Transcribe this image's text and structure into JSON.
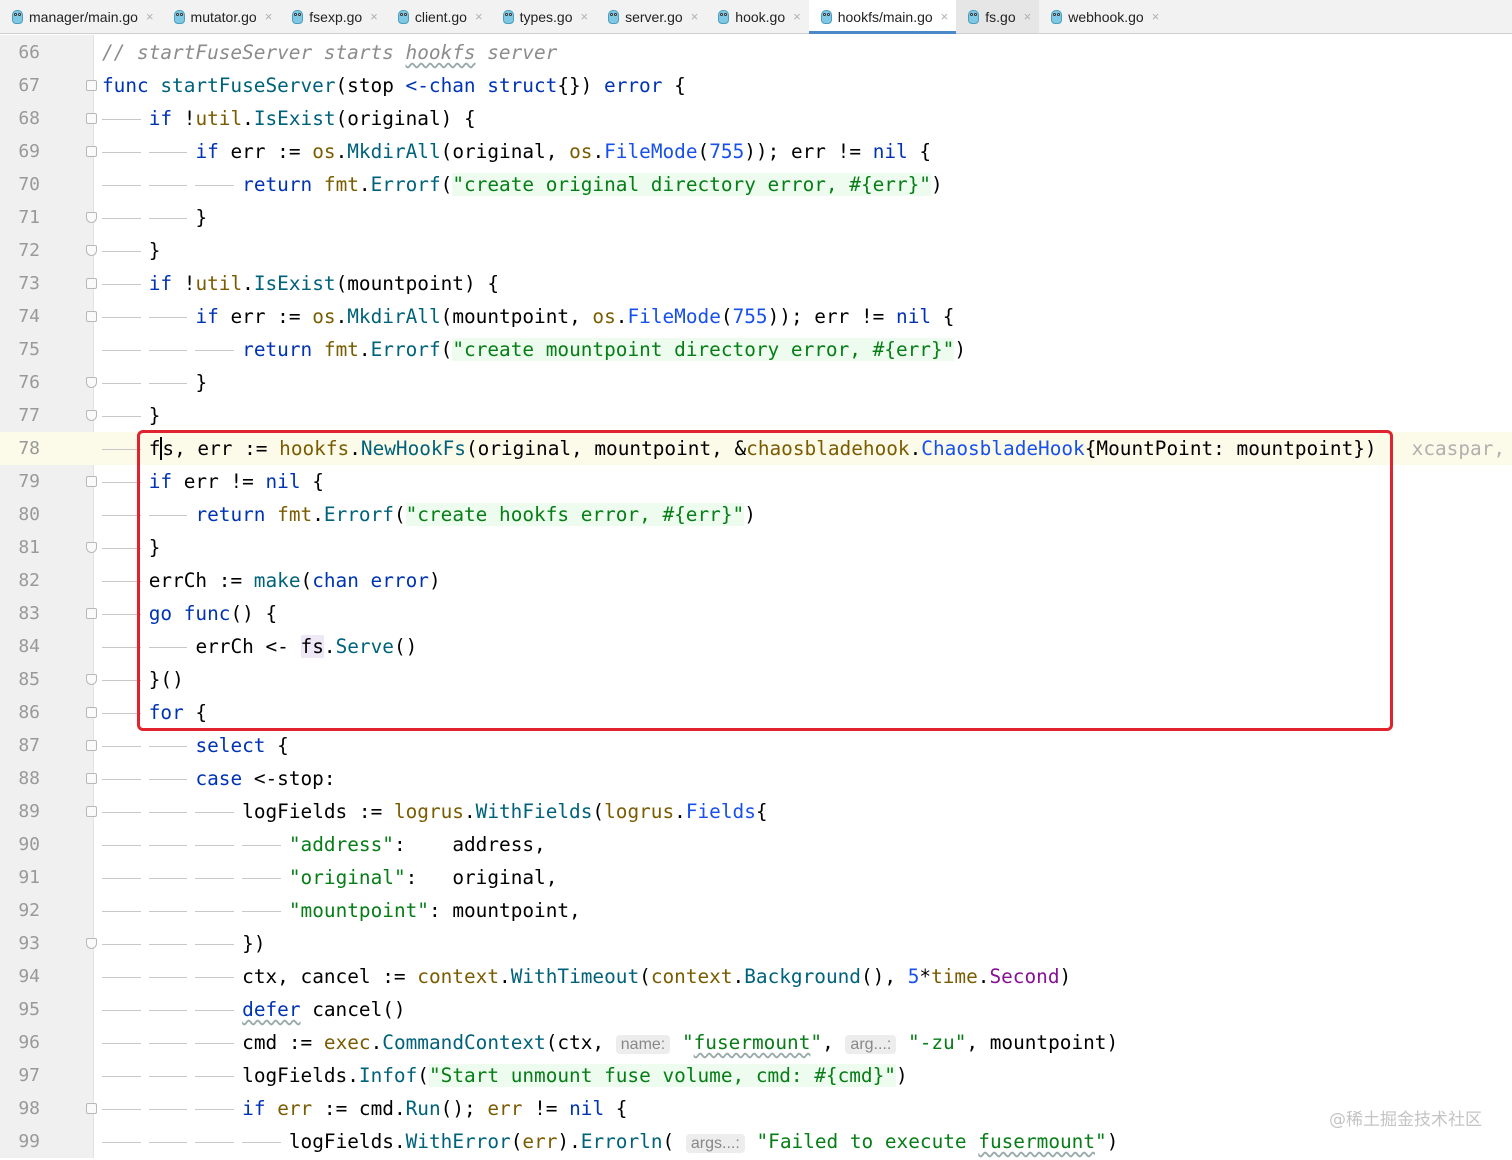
{
  "tabs": [
    {
      "label": "manager/main.go"
    },
    {
      "label": "mutator.go"
    },
    {
      "label": "fsexp.go"
    },
    {
      "label": "client.go"
    },
    {
      "label": "types.go"
    },
    {
      "label": "server.go"
    },
    {
      "label": "hook.go"
    },
    {
      "label": "hookfs/main.go",
      "active": true
    },
    {
      "label": "fs.go"
    },
    {
      "label": "webhook.go"
    }
  ],
  "tab_close_glyph": "×",
  "colors": {
    "active_tab_accent": "#4a88c7",
    "selection_box": "#e0232e",
    "keyword": "#0033b3",
    "string": "#067d17"
  },
  "current_line": 78,
  "highlight_box_lines": [
    78,
    85
  ],
  "watermark": "@稀土掘金技术社区",
  "lines": [
    {
      "n": 66,
      "indent": 0,
      "fold": "",
      "tokens": [
        [
          "cm",
          "// startFuseServer starts "
        ],
        [
          "cm sq",
          "hookfs"
        ],
        [
          "cm",
          " server"
        ]
      ]
    },
    {
      "n": 67,
      "indent": 0,
      "fold": "start",
      "tokens": [
        [
          "kw",
          "func "
        ],
        [
          "fn",
          "startFuseServer"
        ],
        [
          "",
          "(stop "
        ],
        [
          "kw",
          "<-chan struct"
        ],
        [
          "",
          "{}) "
        ],
        [
          "kw",
          "error"
        ],
        [
          "",
          " {"
        ]
      ]
    },
    {
      "n": 68,
      "indent": 1,
      "fold": "start",
      "tokens": [
        [
          "kw",
          "if "
        ],
        [
          "",
          "!"
        ],
        [
          "pk",
          "util"
        ],
        [
          "",
          "."
        ],
        [
          "mt",
          "IsExist"
        ],
        [
          "",
          "(original) {"
        ]
      ]
    },
    {
      "n": 69,
      "indent": 2,
      "fold": "start",
      "tokens": [
        [
          "kw",
          "if "
        ],
        [
          "",
          "err := "
        ],
        [
          "pk",
          "os"
        ],
        [
          "",
          "."
        ],
        [
          "mt",
          "MkdirAll"
        ],
        [
          "",
          "(original, "
        ],
        [
          "pk",
          "os"
        ],
        [
          "",
          "."
        ],
        [
          "ty",
          "FileMode"
        ],
        [
          "",
          "("
        ],
        [
          "num",
          "755"
        ],
        [
          "",
          "));"
        ],
        [
          "",
          " err != "
        ],
        [
          "kw",
          "nil"
        ],
        [
          "",
          " {"
        ]
      ]
    },
    {
      "n": 70,
      "indent": 3,
      "fold": "",
      "tokens": [
        [
          "kw",
          "return "
        ],
        [
          "pk",
          "fmt"
        ],
        [
          "",
          "."
        ],
        [
          "mt",
          "Errorf"
        ],
        [
          "",
          "("
        ],
        [
          "str strbg",
          "\"create original directory error, #{err}\""
        ],
        [
          "",
          ")"
        ]
      ]
    },
    {
      "n": 71,
      "indent": 2,
      "fold": "end",
      "tokens": [
        [
          "",
          "}"
        ]
      ]
    },
    {
      "n": 72,
      "indent": 1,
      "fold": "end",
      "tokens": [
        [
          "",
          "}"
        ]
      ]
    },
    {
      "n": 73,
      "indent": 1,
      "fold": "start",
      "tokens": [
        [
          "kw",
          "if "
        ],
        [
          "",
          "!"
        ],
        [
          "pk",
          "util"
        ],
        [
          "",
          "."
        ],
        [
          "mt",
          "IsExist"
        ],
        [
          "",
          "(mountpoint) {"
        ]
      ]
    },
    {
      "n": 74,
      "indent": 2,
      "fold": "start",
      "tokens": [
        [
          "kw",
          "if "
        ],
        [
          "",
          "err := "
        ],
        [
          "pk",
          "os"
        ],
        [
          "",
          "."
        ],
        [
          "mt",
          "MkdirAll"
        ],
        [
          "",
          "(mountpoint, "
        ],
        [
          "pk",
          "os"
        ],
        [
          "",
          "."
        ],
        [
          "ty",
          "FileMode"
        ],
        [
          "",
          "("
        ],
        [
          "num",
          "755"
        ],
        [
          "",
          "));"
        ],
        [
          "",
          " err != "
        ],
        [
          "kw",
          "nil"
        ],
        [
          "",
          " {"
        ]
      ]
    },
    {
      "n": 75,
      "indent": 3,
      "fold": "",
      "tokens": [
        [
          "kw",
          "return "
        ],
        [
          "pk",
          "fmt"
        ],
        [
          "",
          "."
        ],
        [
          "mt",
          "Errorf"
        ],
        [
          "",
          "("
        ],
        [
          "str strbg",
          "\"create mountpoint directory error, #{err}\""
        ],
        [
          "",
          ")"
        ]
      ]
    },
    {
      "n": 76,
      "indent": 2,
      "fold": "end",
      "tokens": [
        [
          "",
          "}"
        ]
      ]
    },
    {
      "n": 77,
      "indent": 1,
      "fold": "end",
      "tokens": [
        [
          "",
          "}"
        ]
      ]
    },
    {
      "n": 78,
      "indent": 1,
      "fold": "",
      "tokens": [
        [
          "",
          "f"
        ],
        [
          "caret",
          ""
        ],
        [
          "",
          "s, err := "
        ],
        [
          "pk",
          "hookfs"
        ],
        [
          "",
          "."
        ],
        [
          "mt",
          "NewHookFs"
        ],
        [
          "",
          "(original, mountpoint, &"
        ],
        [
          "pk",
          "chaosbladehook"
        ],
        [
          "",
          "."
        ],
        [
          "ty",
          "ChaosbladeHook"
        ],
        [
          "",
          "{MountPoint: mountpoint})"
        ],
        [
          "",
          "   "
        ],
        [
          "author",
          "xcaspar,"
        ]
      ]
    },
    {
      "n": 79,
      "indent": 1,
      "fold": "start",
      "tokens": [
        [
          "kw",
          "if "
        ],
        [
          "",
          "err != "
        ],
        [
          "kw",
          "nil"
        ],
        [
          "",
          " {"
        ]
      ]
    },
    {
      "n": 80,
      "indent": 2,
      "fold": "",
      "tokens": [
        [
          "kw",
          "return "
        ],
        [
          "pk",
          "fmt"
        ],
        [
          "",
          "."
        ],
        [
          "mt",
          "Errorf"
        ],
        [
          "",
          "("
        ],
        [
          "str strbg",
          "\"create hookfs error, #{err}\""
        ],
        [
          "",
          ")"
        ]
      ]
    },
    {
      "n": 81,
      "indent": 1,
      "fold": "end",
      "tokens": [
        [
          "",
          "}"
        ]
      ]
    },
    {
      "n": 82,
      "indent": 1,
      "fold": "",
      "tokens": [
        [
          "",
          "errCh := "
        ],
        [
          "fn",
          "make"
        ],
        [
          "",
          "("
        ],
        [
          "kw",
          "chan error"
        ],
        [
          "",
          ")"
        ]
      ]
    },
    {
      "n": 83,
      "indent": 1,
      "fold": "start",
      "tokens": [
        [
          "kw",
          "go func"
        ],
        [
          "",
          "() {"
        ]
      ]
    },
    {
      "n": 84,
      "indent": 2,
      "fold": "",
      "tokens": [
        [
          "",
          "errCh <- "
        ],
        [
          "hl",
          "fs"
        ],
        [
          "",
          "."
        ],
        [
          "mt",
          "Serve"
        ],
        [
          "",
          "()"
        ]
      ]
    },
    {
      "n": 85,
      "indent": 1,
      "fold": "end",
      "tokens": [
        [
          "",
          "}()"
        ]
      ]
    },
    {
      "n": 86,
      "indent": 1,
      "fold": "start",
      "tokens": [
        [
          "kw",
          "for"
        ],
        [
          "",
          " {"
        ]
      ]
    },
    {
      "n": 87,
      "indent": 2,
      "fold": "start",
      "tokens": [
        [
          "kw",
          "select"
        ],
        [
          "",
          " {"
        ]
      ]
    },
    {
      "n": 88,
      "indent": 2,
      "fold": "start",
      "tokens": [
        [
          "kw",
          "case "
        ],
        [
          "",
          "<-stop:"
        ]
      ]
    },
    {
      "n": 89,
      "indent": 3,
      "fold": "start",
      "tokens": [
        [
          "",
          "logFields := "
        ],
        [
          "pk",
          "logrus"
        ],
        [
          "",
          "."
        ],
        [
          "mt",
          "WithFields"
        ],
        [
          "",
          "("
        ],
        [
          "pk",
          "logrus"
        ],
        [
          "",
          "."
        ],
        [
          "ty",
          "Fields"
        ],
        [
          "",
          "{"
        ]
      ]
    },
    {
      "n": 90,
      "indent": 4,
      "fold": "",
      "tokens": [
        [
          "str",
          "\"address\""
        ],
        [
          "",
          ":    address,"
        ]
      ]
    },
    {
      "n": 91,
      "indent": 4,
      "fold": "",
      "tokens": [
        [
          "str",
          "\"original\""
        ],
        [
          "",
          ":   original,"
        ]
      ]
    },
    {
      "n": 92,
      "indent": 4,
      "fold": "",
      "tokens": [
        [
          "str",
          "\"mountpoint\""
        ],
        [
          "",
          ": mountpoint,"
        ]
      ]
    },
    {
      "n": 93,
      "indent": 3,
      "fold": "end",
      "tokens": [
        [
          "",
          "})"
        ]
      ]
    },
    {
      "n": 94,
      "indent": 3,
      "fold": "",
      "tokens": [
        [
          "",
          "ctx, cancel := "
        ],
        [
          "pk",
          "context"
        ],
        [
          "",
          "."
        ],
        [
          "mt",
          "WithTimeout"
        ],
        [
          "",
          "("
        ],
        [
          "pk",
          "context"
        ],
        [
          "",
          "."
        ],
        [
          "mt",
          "Background"
        ],
        [
          "",
          "(), "
        ],
        [
          "num",
          "5"
        ],
        [
          "",
          "*"
        ],
        [
          "pk",
          "time"
        ],
        [
          "",
          "."
        ],
        [
          "ck",
          "Second"
        ],
        [
          "",
          ")"
        ]
      ]
    },
    {
      "n": 95,
      "indent": 3,
      "fold": "",
      "tokens": [
        [
          "kw sq",
          "defer"
        ],
        [
          "",
          " cancel()"
        ]
      ]
    },
    {
      "n": 96,
      "indent": 3,
      "fold": "",
      "tokens": [
        [
          "",
          "cmd := "
        ],
        [
          "pk",
          "exec"
        ],
        [
          "",
          "."
        ],
        [
          "mt",
          "CommandContext"
        ],
        [
          "",
          "(ctx, "
        ],
        [
          "hint",
          "name:"
        ],
        [
          "",
          " "
        ],
        [
          "str",
          "\""
        ],
        [
          "str sq",
          "fusermount"
        ],
        [
          "str",
          "\""
        ],
        [
          "",
          ", "
        ],
        [
          "hint",
          "arg...:"
        ],
        [
          "",
          " "
        ],
        [
          "str",
          "\"-zu\""
        ],
        [
          "",
          ", mountpoint)"
        ]
      ]
    },
    {
      "n": 97,
      "indent": 3,
      "fold": "",
      "tokens": [
        [
          "",
          "logFields."
        ],
        [
          "mt",
          "Infof"
        ],
        [
          "",
          "("
        ],
        [
          "str strbg",
          "\"Start unmount fuse volume, cmd: #{cmd}\""
        ],
        [
          "",
          ")"
        ]
      ]
    },
    {
      "n": 98,
      "indent": 3,
      "fold": "start",
      "tokens": [
        [
          "kw",
          "if "
        ],
        [
          "pk",
          "err"
        ],
        [
          "",
          " := cmd."
        ],
        [
          "mt",
          "Run"
        ],
        [
          "",
          "(); "
        ],
        [
          "pk",
          "err"
        ],
        [
          "",
          " != "
        ],
        [
          "kw",
          "nil"
        ],
        [
          "",
          " {"
        ]
      ]
    },
    {
      "n": 99,
      "indent": 4,
      "fold": "",
      "tokens": [
        [
          "",
          "logFields."
        ],
        [
          "mt",
          "WithError"
        ],
        [
          "",
          "("
        ],
        [
          "pk",
          "err"
        ],
        [
          "",
          ")."
        ],
        [
          "mt",
          "Errorln"
        ],
        [
          "",
          "( "
        ],
        [
          "hint",
          "args...:"
        ],
        [
          "",
          " "
        ],
        [
          "str",
          "\"Failed to execute "
        ],
        [
          "str sq",
          "fusermount"
        ],
        [
          "str",
          "\""
        ],
        [
          "",
          ")"
        ]
      ]
    }
  ]
}
